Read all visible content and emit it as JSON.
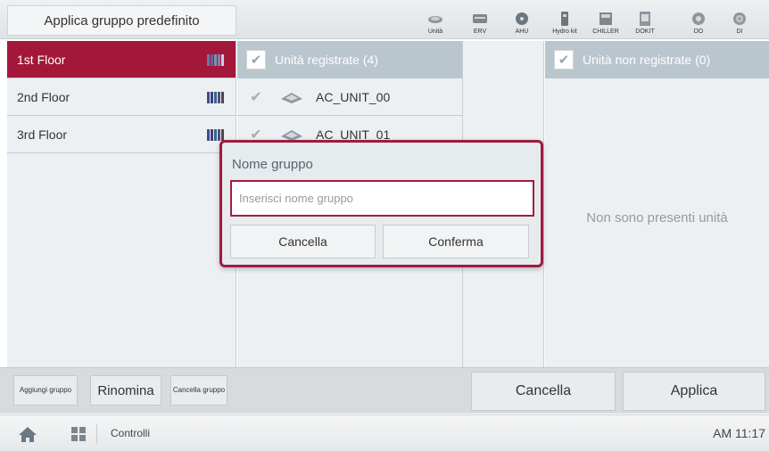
{
  "header": {
    "title": "Applica gruppo predefinito",
    "device_types": [
      {
        "label": "Unità",
        "icon": "indoor-unit-icon"
      },
      {
        "label": "ERV",
        "icon": "erv-icon"
      },
      {
        "label": "AHU",
        "icon": "ahu-fan-icon"
      },
      {
        "label": "Hydro kit",
        "icon": "hydro-kit-icon"
      },
      {
        "label": "CHILLER",
        "icon": "chiller-icon"
      },
      {
        "label": "DOKIT",
        "icon": "dokit-icon"
      },
      {
        "label": "DO",
        "icon": "do-icon"
      },
      {
        "label": "DI",
        "icon": "di-icon"
      }
    ]
  },
  "groups": [
    {
      "label": "1st Floor",
      "selected": true
    },
    {
      "label": "2nd Floor",
      "selected": false
    },
    {
      "label": "3rd Floor",
      "selected": false
    }
  ],
  "registered": {
    "header": "Unità registrate (4)",
    "units": [
      "AC_UNIT_00",
      "AC_UNIT_01"
    ]
  },
  "unregistered": {
    "header": "Unità non registrate (0)",
    "empty_message": "Non sono presenti unità"
  },
  "actions": {
    "add_group": "Aggiungi gruppo",
    "rename": "Rinomina",
    "delete_group": "Cancella gruppo",
    "cancel": "Cancella",
    "apply": "Applica"
  },
  "dialog": {
    "title": "Nome gruppo",
    "input_value": "",
    "input_placeholder": "Inserisci nome gruppo",
    "cancel": "Cancella",
    "confirm": "Conferma"
  },
  "footer": {
    "label": "Controlli",
    "time": "AM 11:17"
  },
  "colors": {
    "accent": "#a3183a",
    "panel_bg": "#edf0f2",
    "header_blue": "#b9c6ce"
  }
}
